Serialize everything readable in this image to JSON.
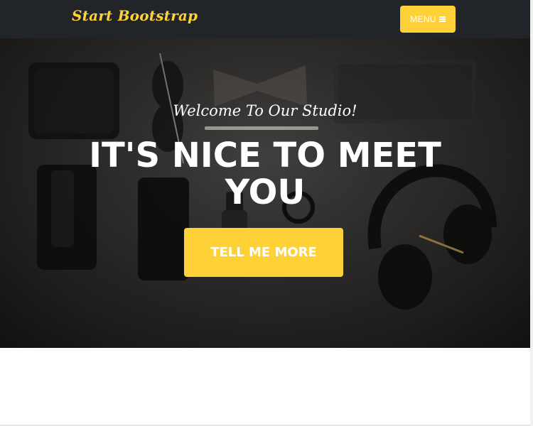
{
  "navbar": {
    "brand": "Start Bootstrap",
    "menu_label": "MENU",
    "menu_icon": "bars-icon"
  },
  "hero": {
    "subheading": "Welcome To Our Studio!",
    "heading": "IT'S NICE TO MEET YOU",
    "button_label": "TELL ME MORE",
    "background_image": "flat-lay of wallet, sunglasses, bow tie, notebook, pen, phone, watch and headphones on dark surface"
  },
  "colors": {
    "accent": "#fed136",
    "navbar": "#212529",
    "text_light": "#ffffff"
  }
}
